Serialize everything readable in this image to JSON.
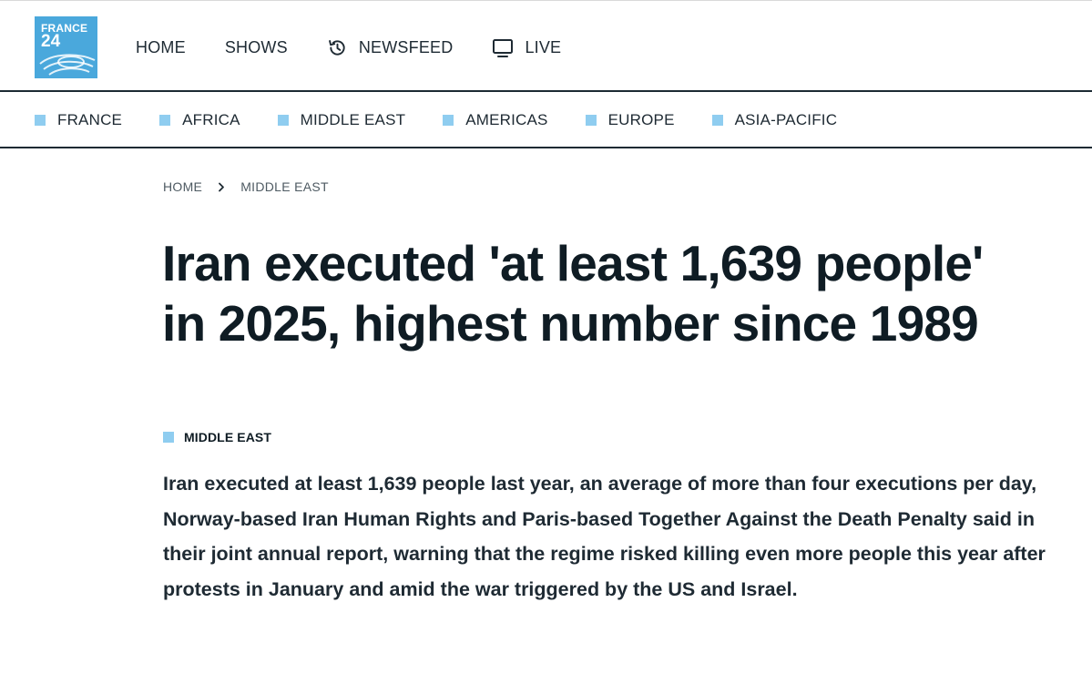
{
  "logo": {
    "line1": "FRANCE",
    "line2": "24",
    "brand_color": "#4aa8dc"
  },
  "main_nav": {
    "items": [
      {
        "label": "HOME",
        "icon": ""
      },
      {
        "label": "SHOWS",
        "icon": ""
      },
      {
        "label": "NEWSFEED",
        "icon": "history-icon"
      },
      {
        "label": "LIVE",
        "icon": "tv-icon"
      }
    ]
  },
  "region_nav": {
    "accent": "#8fcdf0",
    "items": [
      {
        "label": "FRANCE"
      },
      {
        "label": "AFRICA"
      },
      {
        "label": "MIDDLE EAST"
      },
      {
        "label": "AMERICAS"
      },
      {
        "label": "EUROPE"
      },
      {
        "label": "ASIA-PACIFIC"
      }
    ]
  },
  "breadcrumb": {
    "home": "HOME",
    "section": "MIDDLE EAST"
  },
  "article": {
    "headline": "Iran executed 'at least 1,639 people' in 2025, highest number since 1989",
    "tag": "MIDDLE EAST",
    "lede": "Iran executed at least 1,639 people last year, an average of more than four executions per day, Norway-based Iran Human Rights and Paris-based Together Against the Death Penalty said in their joint annual report, warning that the regime risked killing even more people this year after protests in January and amid the war triggered by the US and Israel."
  }
}
